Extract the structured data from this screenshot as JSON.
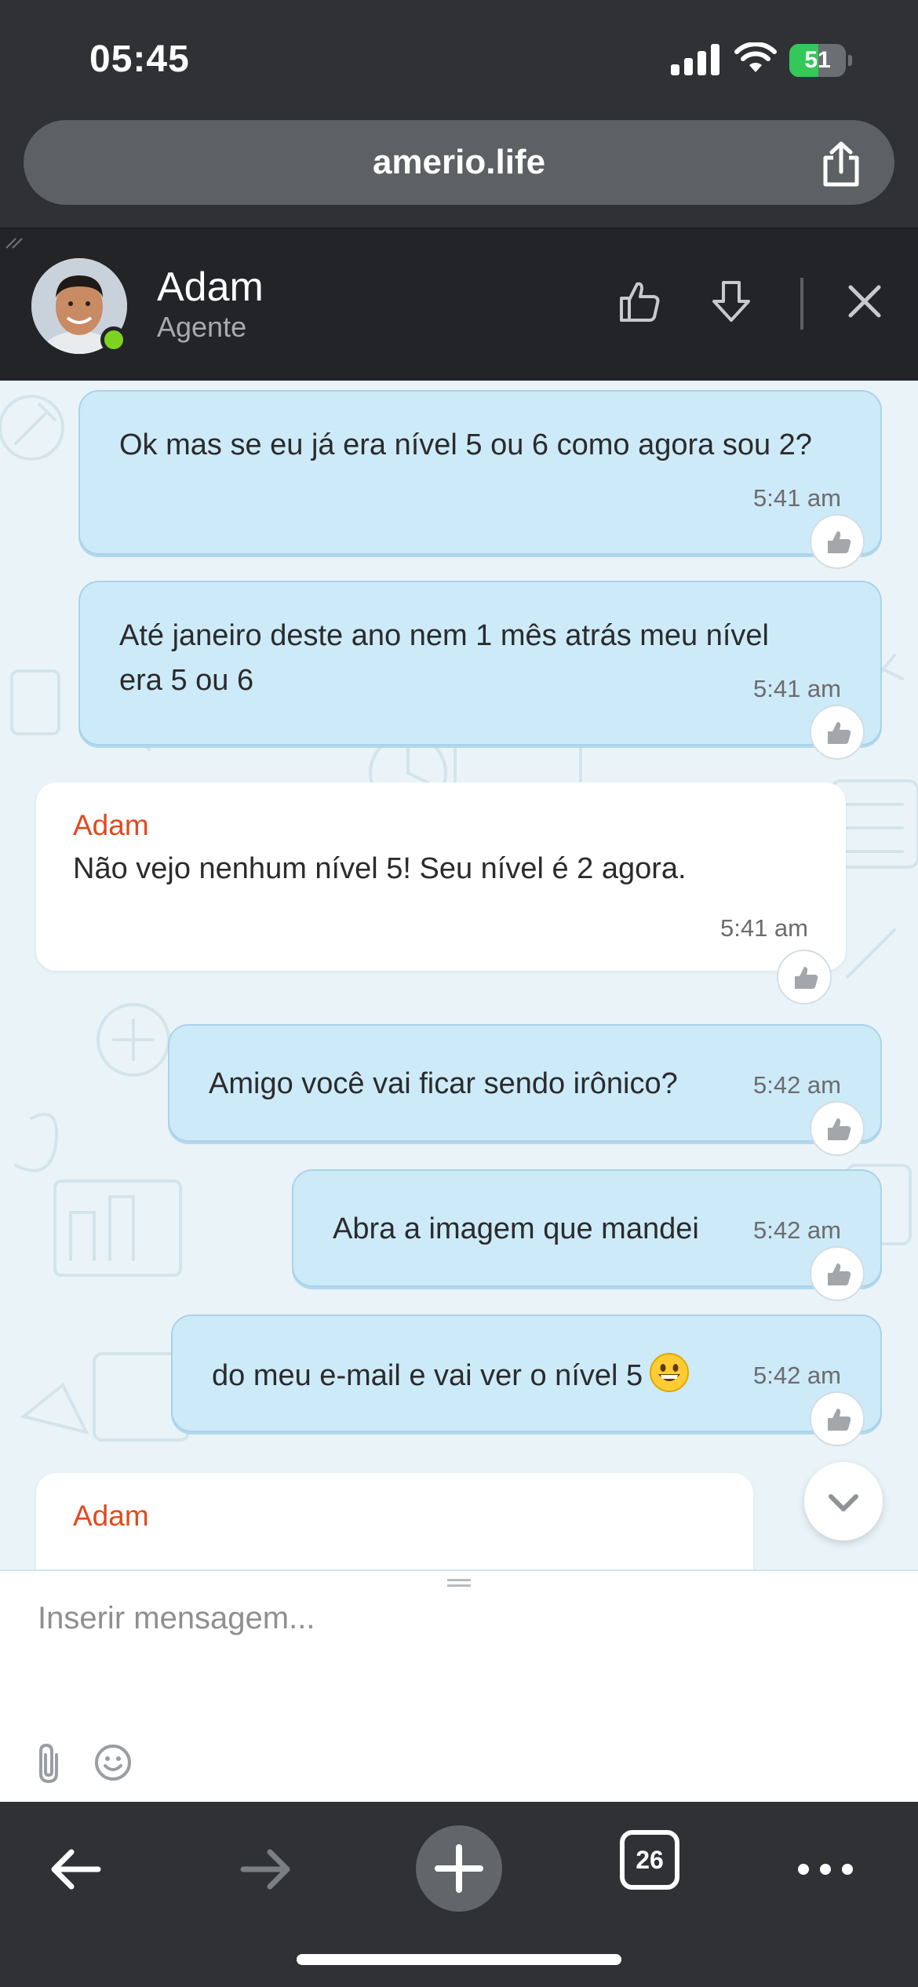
{
  "status": {
    "time": "05:45",
    "battery": "51",
    "battery_level": 0.51
  },
  "browser": {
    "url": "amerio.life"
  },
  "header": {
    "agent_name": "Adam",
    "agent_role": "Agente"
  },
  "messages": [
    {
      "dir": "out",
      "text": "Ok mas se eu já era nível 5 ou 6 como agora sou 2?",
      "time": "5:41 am"
    },
    {
      "dir": "out",
      "text": "Até janeiro deste ano nem 1 mês atrás meu nível era 5 ou 6",
      "time": "5:41 am"
    },
    {
      "dir": "in",
      "sender": "Adam",
      "text": "Não vejo nenhum nível 5! Seu nível é 2 agora.",
      "time": "5:41 am"
    },
    {
      "dir": "out",
      "text": "Amigo você vai ficar sendo irônico?",
      "time": "5:42 am"
    },
    {
      "dir": "out",
      "text": "Abra a imagem que mandei",
      "time": "5:42 am"
    },
    {
      "dir": "out",
      "text": "do meu e-mail e vai ver o nível 5",
      "emoji": "grinning-face",
      "time": "5:42 am"
    },
    {
      "dir": "in",
      "sender": "Adam",
      "text": "",
      "time": ""
    }
  ],
  "composer": {
    "placeholder": "Inserir mensagem..."
  },
  "bottom_bar": {
    "tab_count": "26"
  }
}
